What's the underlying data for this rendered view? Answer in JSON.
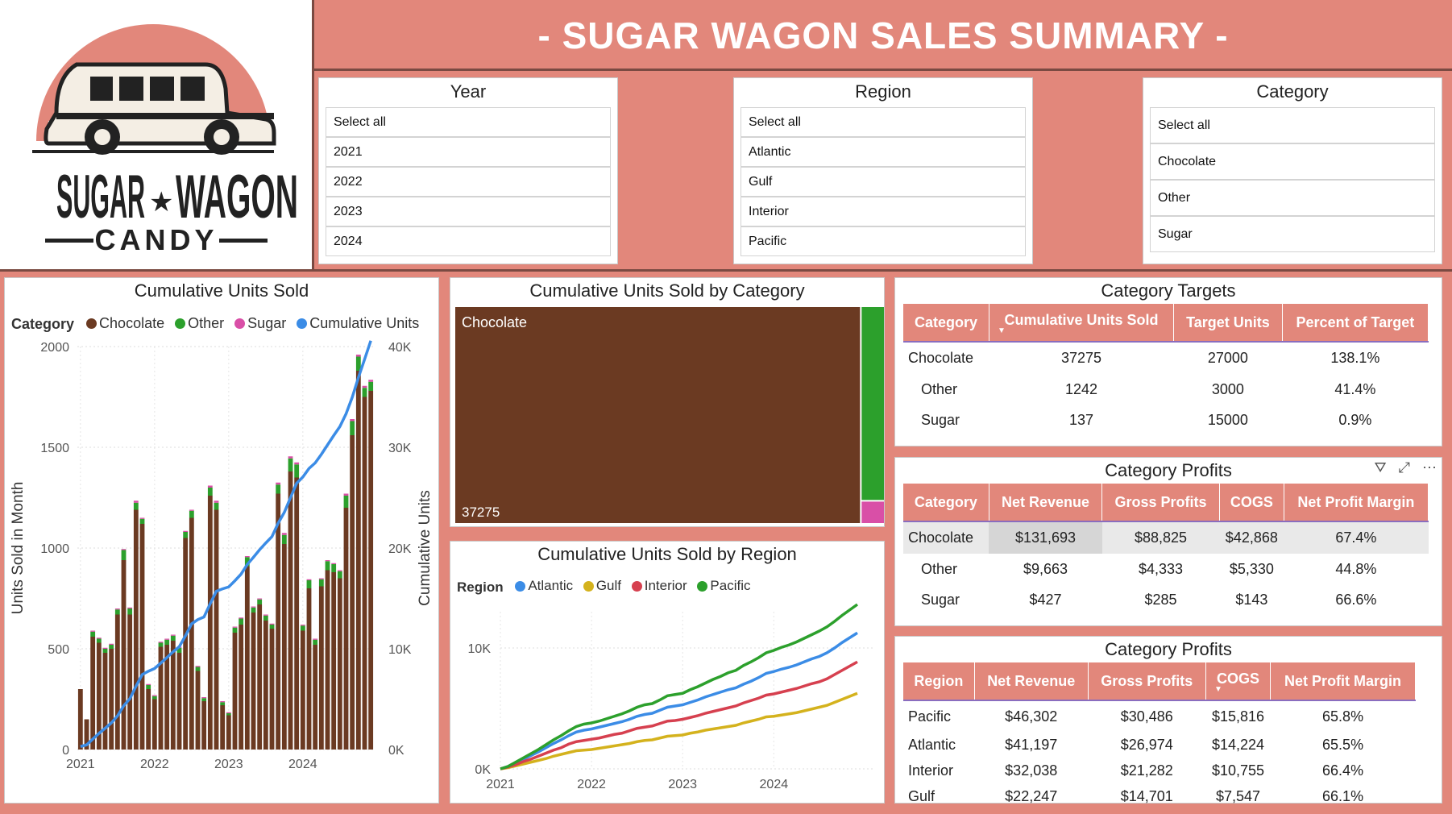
{
  "header": {
    "title": "- SUGAR WAGON SALES SUMMARY -"
  },
  "logo": {
    "brand_left": "SUGAR",
    "brand_right": "WAGON",
    "sub": "CANDY"
  },
  "slicers": {
    "year": {
      "title": "Year",
      "options": [
        "Select all",
        "2021",
        "2022",
        "2023",
        "2024"
      ]
    },
    "region": {
      "title": "Region",
      "options": [
        "Select all",
        "Atlantic",
        "Gulf",
        "Interior",
        "Pacific"
      ]
    },
    "category": {
      "title": "Category",
      "options": [
        "Select all",
        "Chocolate",
        "Other",
        "Sugar"
      ]
    }
  },
  "colors": {
    "accent": "#e2877b",
    "chocolate": "#6b3a22",
    "other": "#2ca02c",
    "sugar": "#d94fa7",
    "cumulative": "#3b8ce6",
    "atlantic": "#3b8ce6",
    "gulf": "#d4b21d",
    "interior": "#d6404f",
    "pacific": "#2ca02c"
  },
  "chart_data": [
    {
      "type": "bar",
      "title": "Cumulative Units Sold",
      "legend_title": "Category",
      "series_names": [
        "Chocolate",
        "Other",
        "Sugar",
        "Cumulative Units"
      ],
      "ylabel": "Units Sold in Month",
      "y2label": "Cumulative Units",
      "ylim": [
        0,
        2000
      ],
      "y2lim": [
        0,
        40000
      ],
      "yticks": [
        "0",
        "500",
        "1000",
        "1500",
        "2000"
      ],
      "y2ticks": [
        "0K",
        "10K",
        "20K",
        "30K",
        "40K"
      ],
      "xticks": [
        "2021",
        "2022",
        "2023",
        "2024"
      ],
      "chocolate": [
        300,
        150,
        560,
        530,
        480,
        500,
        670,
        940,
        670,
        1190,
        1120,
        300,
        250,
        510,
        520,
        540,
        480,
        1050,
        1150,
        390,
        240,
        1260,
        1190,
        220,
        170,
        580,
        620,
        910,
        680,
        720,
        640,
        600,
        1270,
        1020,
        1380,
        1350,
        590,
        800,
        520,
        810,
        890,
        880,
        850,
        1200,
        1560,
        1880,
        1750,
        1780
      ],
      "other": [
        0,
        0,
        25,
        20,
        20,
        20,
        25,
        50,
        30,
        35,
        25,
        20,
        15,
        20,
        25,
        25,
        25,
        30,
        35,
        20,
        15,
        40,
        35,
        15,
        10,
        25,
        30,
        45,
        25,
        25,
        25,
        20,
        45,
        45,
        65,
        65,
        25,
        40,
        25,
        35,
        45,
        40,
        35,
        60,
        70,
        70,
        45,
        45
      ],
      "sugar": [
        0,
        0,
        5,
        5,
        5,
        5,
        5,
        5,
        5,
        10,
        5,
        5,
        5,
        5,
        5,
        5,
        5,
        5,
        5,
        5,
        5,
        10,
        10,
        5,
        5,
        5,
        5,
        5,
        5,
        5,
        5,
        5,
        10,
        10,
        10,
        10,
        5,
        5,
        5,
        5,
        5,
        5,
        5,
        10,
        10,
        10,
        10,
        10
      ],
      "cumulative": [
        300,
        460,
        1040,
        1600,
        2110,
        2640,
        3340,
        4340,
        5050,
        6290,
        7440,
        7770,
        8040,
        8580,
        9130,
        9700,
        10210,
        11290,
        12480,
        12900,
        13160,
        14470,
        15710,
        15950,
        16140,
        16750,
        17410,
        18370,
        19080,
        19830,
        20500,
        21130,
        22460,
        23540,
        25000,
        26430,
        27050,
        27900,
        28450,
        29300,
        30240,
        31170,
        32060,
        33330,
        34970,
        36930,
        38740,
        40580
      ]
    },
    {
      "type": "heatmap",
      "title": "Cumulative Units Sold by Category",
      "categories": [
        "Chocolate",
        "Other",
        "Sugar"
      ],
      "values": [
        37275,
        1242,
        137
      ],
      "label_shown": "Chocolate",
      "value_label": "37275"
    },
    {
      "type": "line",
      "title": "Cumulative Units Sold by Region",
      "legend_title": "Region",
      "ylim": [
        0,
        13000
      ],
      "yticks": [
        "0K",
        "10K"
      ],
      "xticks": [
        "2021",
        "2022",
        "2023",
        "2024"
      ],
      "series": [
        {
          "name": "Atlantic",
          "values": [
            0,
            200,
            500,
            800,
            1100,
            1400,
            1750,
            2100,
            2400,
            2750,
            3050,
            3200,
            3300,
            3450,
            3600,
            3750,
            3900,
            4100,
            4350,
            4500,
            4600,
            4850,
            5100,
            5200,
            5300,
            5500,
            5700,
            5950,
            6150,
            6350,
            6550,
            6700,
            7000,
            7250,
            7550,
            7900,
            8050,
            8250,
            8400,
            8600,
            8850,
            9100,
            9300,
            9600,
            10000,
            10450,
            10850,
            11250
          ]
        },
        {
          "name": "Gulf",
          "values": [
            0,
            100,
            250,
            400,
            550,
            700,
            850,
            1050,
            1200,
            1350,
            1500,
            1550,
            1600,
            1700,
            1800,
            1900,
            2000,
            2100,
            2250,
            2350,
            2400,
            2550,
            2700,
            2750,
            2800,
            2950,
            3050,
            3200,
            3300,
            3400,
            3500,
            3600,
            3800,
            3950,
            4100,
            4300,
            4350,
            4450,
            4550,
            4650,
            4800,
            4950,
            5100,
            5250,
            5500,
            5750,
            6000,
            6250
          ]
        },
        {
          "name": "Interior",
          "values": [
            0,
            150,
            350,
            600,
            800,
            1050,
            1300,
            1550,
            1750,
            2050,
            2250,
            2350,
            2450,
            2550,
            2700,
            2850,
            2950,
            3150,
            3350,
            3450,
            3550,
            3750,
            3950,
            4000,
            4100,
            4250,
            4400,
            4600,
            4750,
            4900,
            5050,
            5200,
            5450,
            5650,
            5850,
            6100,
            6200,
            6350,
            6500,
            6650,
            6850,
            7050,
            7200,
            7450,
            7800,
            8150,
            8500,
            8850
          ]
        },
        {
          "name": "Pacific",
          "values": [
            0,
            200,
            550,
            900,
            1250,
            1600,
            2000,
            2400,
            2750,
            3150,
            3500,
            3700,
            3800,
            3950,
            4150,
            4350,
            4550,
            4800,
            5100,
            5300,
            5400,
            5700,
            6050,
            6150,
            6250,
            6550,
            6800,
            7100,
            7400,
            7650,
            7950,
            8150,
            8550,
            8850,
            9200,
            9600,
            9800,
            10050,
            10250,
            10500,
            10800,
            11100,
            11400,
            11750,
            12200,
            12700,
            13150,
            13600
          ]
        }
      ]
    },
    {
      "type": "table",
      "title": "Category Targets",
      "columns": [
        "Category",
        "Cumulative Units Sold",
        "Target Units",
        "Percent of Target"
      ],
      "rows": [
        [
          "Chocolate",
          "37275",
          "27000",
          "138.1%"
        ],
        [
          "Other",
          "1242",
          "3000",
          "41.4%"
        ],
        [
          "Sugar",
          "137",
          "15000",
          "0.9%"
        ]
      ]
    },
    {
      "type": "table",
      "title": "Category Profits",
      "columns": [
        "Category",
        "Net Revenue",
        "Gross Profits",
        "COGS",
        "Net Profit Margin"
      ],
      "rows": [
        [
          "Chocolate",
          "$131,693",
          "$88,825",
          "$42,868",
          "67.4%"
        ],
        [
          "Other",
          "$9,663",
          "$4,333",
          "$5,330",
          "44.8%"
        ],
        [
          "Sugar",
          "$427",
          "$285",
          "$143",
          "66.6%"
        ]
      ]
    },
    {
      "type": "table",
      "title": "Category Profits",
      "columns": [
        "Region",
        "Net Revenue",
        "Gross Profits",
        "COGS",
        "Net Profit Margin"
      ],
      "rows": [
        [
          "Pacific",
          "$46,302",
          "$30,486",
          "$15,816",
          "65.8%"
        ],
        [
          "Atlantic",
          "$41,197",
          "$26,974",
          "$14,224",
          "65.5%"
        ],
        [
          "Interior",
          "$32,038",
          "$21,282",
          "$10,755",
          "66.4%"
        ],
        [
          "Gulf",
          "$22,247",
          "$14,701",
          "$7,547",
          "66.1%"
        ]
      ]
    }
  ]
}
